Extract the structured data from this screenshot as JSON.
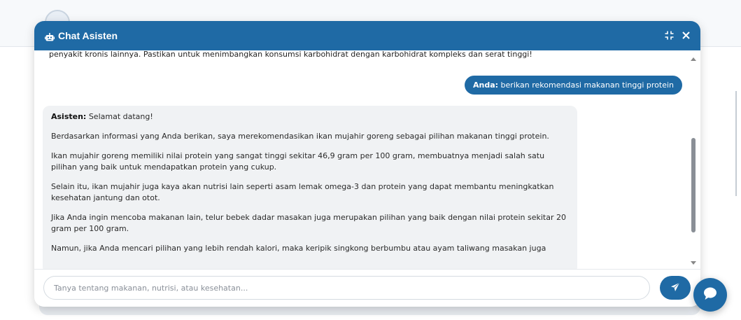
{
  "chat": {
    "title": "Chat Asisten",
    "previous_text": "penyakit kronis lainnya. Pastikan untuk menimbangkan konsumsi karbohidrat dengan karbohidrat kompleks dan serat tinggi!",
    "user_message": {
      "sender": "Anda:",
      "text": "berikan rekomendasi makanan tinggi protein"
    },
    "bot_message": {
      "sender": "Asisten:",
      "greeting": "Selamat datang!",
      "paragraphs": [
        "Berdasarkan informasi yang Anda berikan, saya merekomendasikan ikan mujahir goreng sebagai pilihan makanan tinggi protein.",
        "Ikan mujahir goreng memiliki nilai protein yang sangat tinggi sekitar 46,9 gram per 100 gram, membuatnya menjadi salah satu pilihan yang baik untuk mendapatkan protein yang cukup.",
        "Selain itu, ikan mujahir juga kaya akan nutrisi lain seperti asam lemak omega-3 dan protein yang dapat membantu meningkatkan kesehatan jantung dan otot.",
        "Jika Anda ingin mencoba makanan lain, telur bebek dadar masakan juga merupakan pilihan yang baik dengan nilai protein sekitar 20 gram per 100 gram.",
        "Namun, jika Anda mencari pilihan yang lebih rendah kalori, maka keripik singkong berbumbu atau ayam taliwang masakan juga"
      ]
    },
    "input": {
      "placeholder": "Tanya tentang makanan, nutrisi, atau kesehatan...",
      "value": ""
    }
  },
  "icons": {
    "header": "robot-icon",
    "minimize": "compress-icon",
    "close": "close-icon",
    "send": "paper-plane-icon",
    "fab": "chat-bubble-icon"
  },
  "colors": {
    "primary": "#1f6aa5",
    "bot_bubble": "#f0f2f4",
    "white": "#ffffff"
  }
}
